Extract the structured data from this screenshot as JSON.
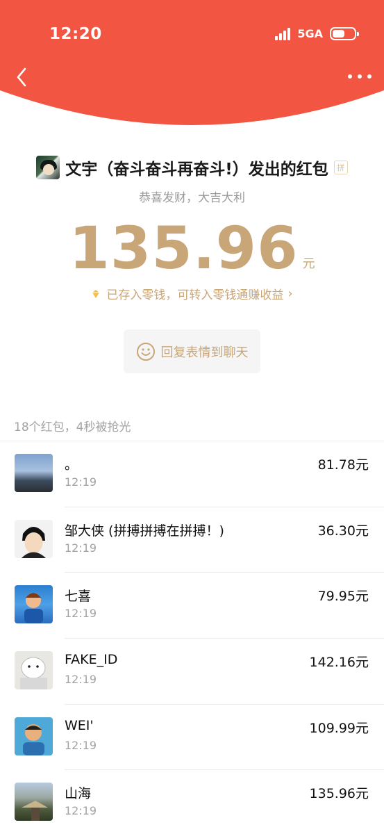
{
  "status_bar": {
    "time": "12:20",
    "network": "5GA"
  },
  "sender": {
    "title": "文宇（奋斗奋斗再奋斗!）发出的红包",
    "badge": "拼"
  },
  "greeting": "恭喜发财，大吉大利",
  "amount": {
    "value": "135.96",
    "unit": "元"
  },
  "deposit_link": "已存入零钱，可转入零钱通赚收益",
  "reply_button": "回复表情到聊天",
  "summary": "18个红包，4秒被抢光",
  "recipients": [
    {
      "name": "。",
      "time": "12:19",
      "amount": "81.78元"
    },
    {
      "name": "邹大侠 (拼搏拼搏在拼搏！)",
      "time": "12:19",
      "amount": "36.30元"
    },
    {
      "name": "七喜",
      "time": "12:19",
      "amount": "79.95元"
    },
    {
      "name": "FAKE_ID",
      "time": "12:19",
      "amount": "142.16元"
    },
    {
      "name": "WEI'",
      "time": "12:19",
      "amount": "109.99元"
    },
    {
      "name": "山海",
      "time": "12:19",
      "amount": "135.96元"
    }
  ],
  "colors": {
    "header_red": "#f25642",
    "gold": "#c9a678",
    "gray_text": "#a3a3a3"
  },
  "icons": [
    "back-arrow-icon",
    "more-dots-icon",
    "signal-icon",
    "battery-icon",
    "coin-icon",
    "chevron-right-icon",
    "smile-icon",
    "pin-icon"
  ]
}
